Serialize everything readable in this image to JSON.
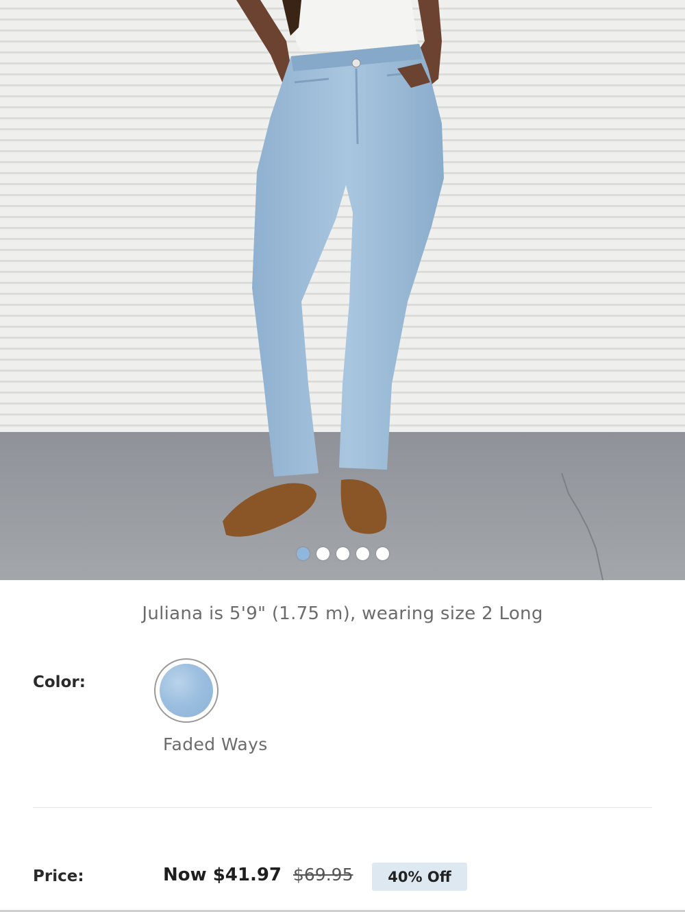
{
  "product_image": {
    "carousel": {
      "total": 5,
      "active_index": 0
    }
  },
  "model_info": "Juliana is 5'9\" (1.75 m), wearing size 2 Long",
  "color": {
    "label": "Color:",
    "selected_name": "Faded Ways",
    "swatch_color": "#9cbfe0"
  },
  "price": {
    "label": "Price:",
    "now": "Now $41.97",
    "was": "$69.95",
    "discount": "40% Off"
  },
  "colors": {
    "wall": "#eeeeec",
    "floor": "#8d9096",
    "denim": "#9cbcd8",
    "shoe": "#8a5527",
    "badge_bg": "#dde8f1"
  }
}
